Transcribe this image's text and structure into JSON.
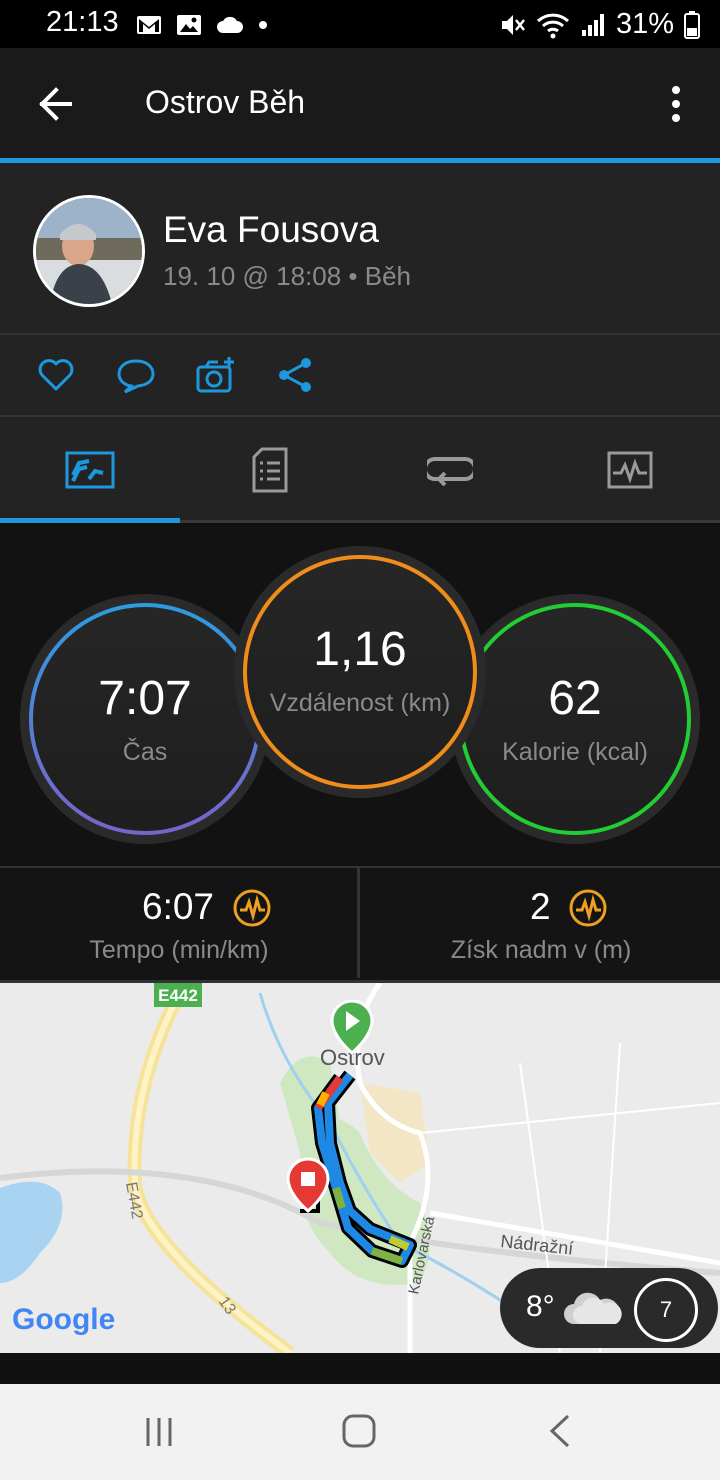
{
  "status_bar": {
    "time": "21:13",
    "battery": "31%"
  },
  "app_bar": {
    "title": "Ostrov Běh"
  },
  "profile": {
    "name": "Eva Fousova",
    "meta": "19. 10 @ 18:08 • Běh"
  },
  "stats": {
    "time": {
      "value": "7:07",
      "label": "Čas"
    },
    "distance": {
      "value": "1,16",
      "label": "Vzdálenost (km)"
    },
    "calories": {
      "value": "62",
      "label": "Kalorie (kcal)"
    }
  },
  "metrics": {
    "pace": {
      "value": "6:07",
      "label": "Tempo (min/km)"
    },
    "elevation": {
      "value": "2",
      "label": "Získ nadm v (m)"
    }
  },
  "map": {
    "road_label_1": "E442",
    "road_label_2": "E442",
    "road_label_3": "13",
    "city_label": "Ostrov",
    "street_1": "Nádražní",
    "street_2": "Karlovarská",
    "google_logo": "Google"
  },
  "weather": {
    "temperature": "8°",
    "wind": "7"
  },
  "colors": {
    "accent": "#1d97dd",
    "distance_ring": "#f08c1a",
    "calories_ring": "#22cc33",
    "time_ring_top": "#2b9de0",
    "time_ring_bottom": "#7b62c8"
  }
}
